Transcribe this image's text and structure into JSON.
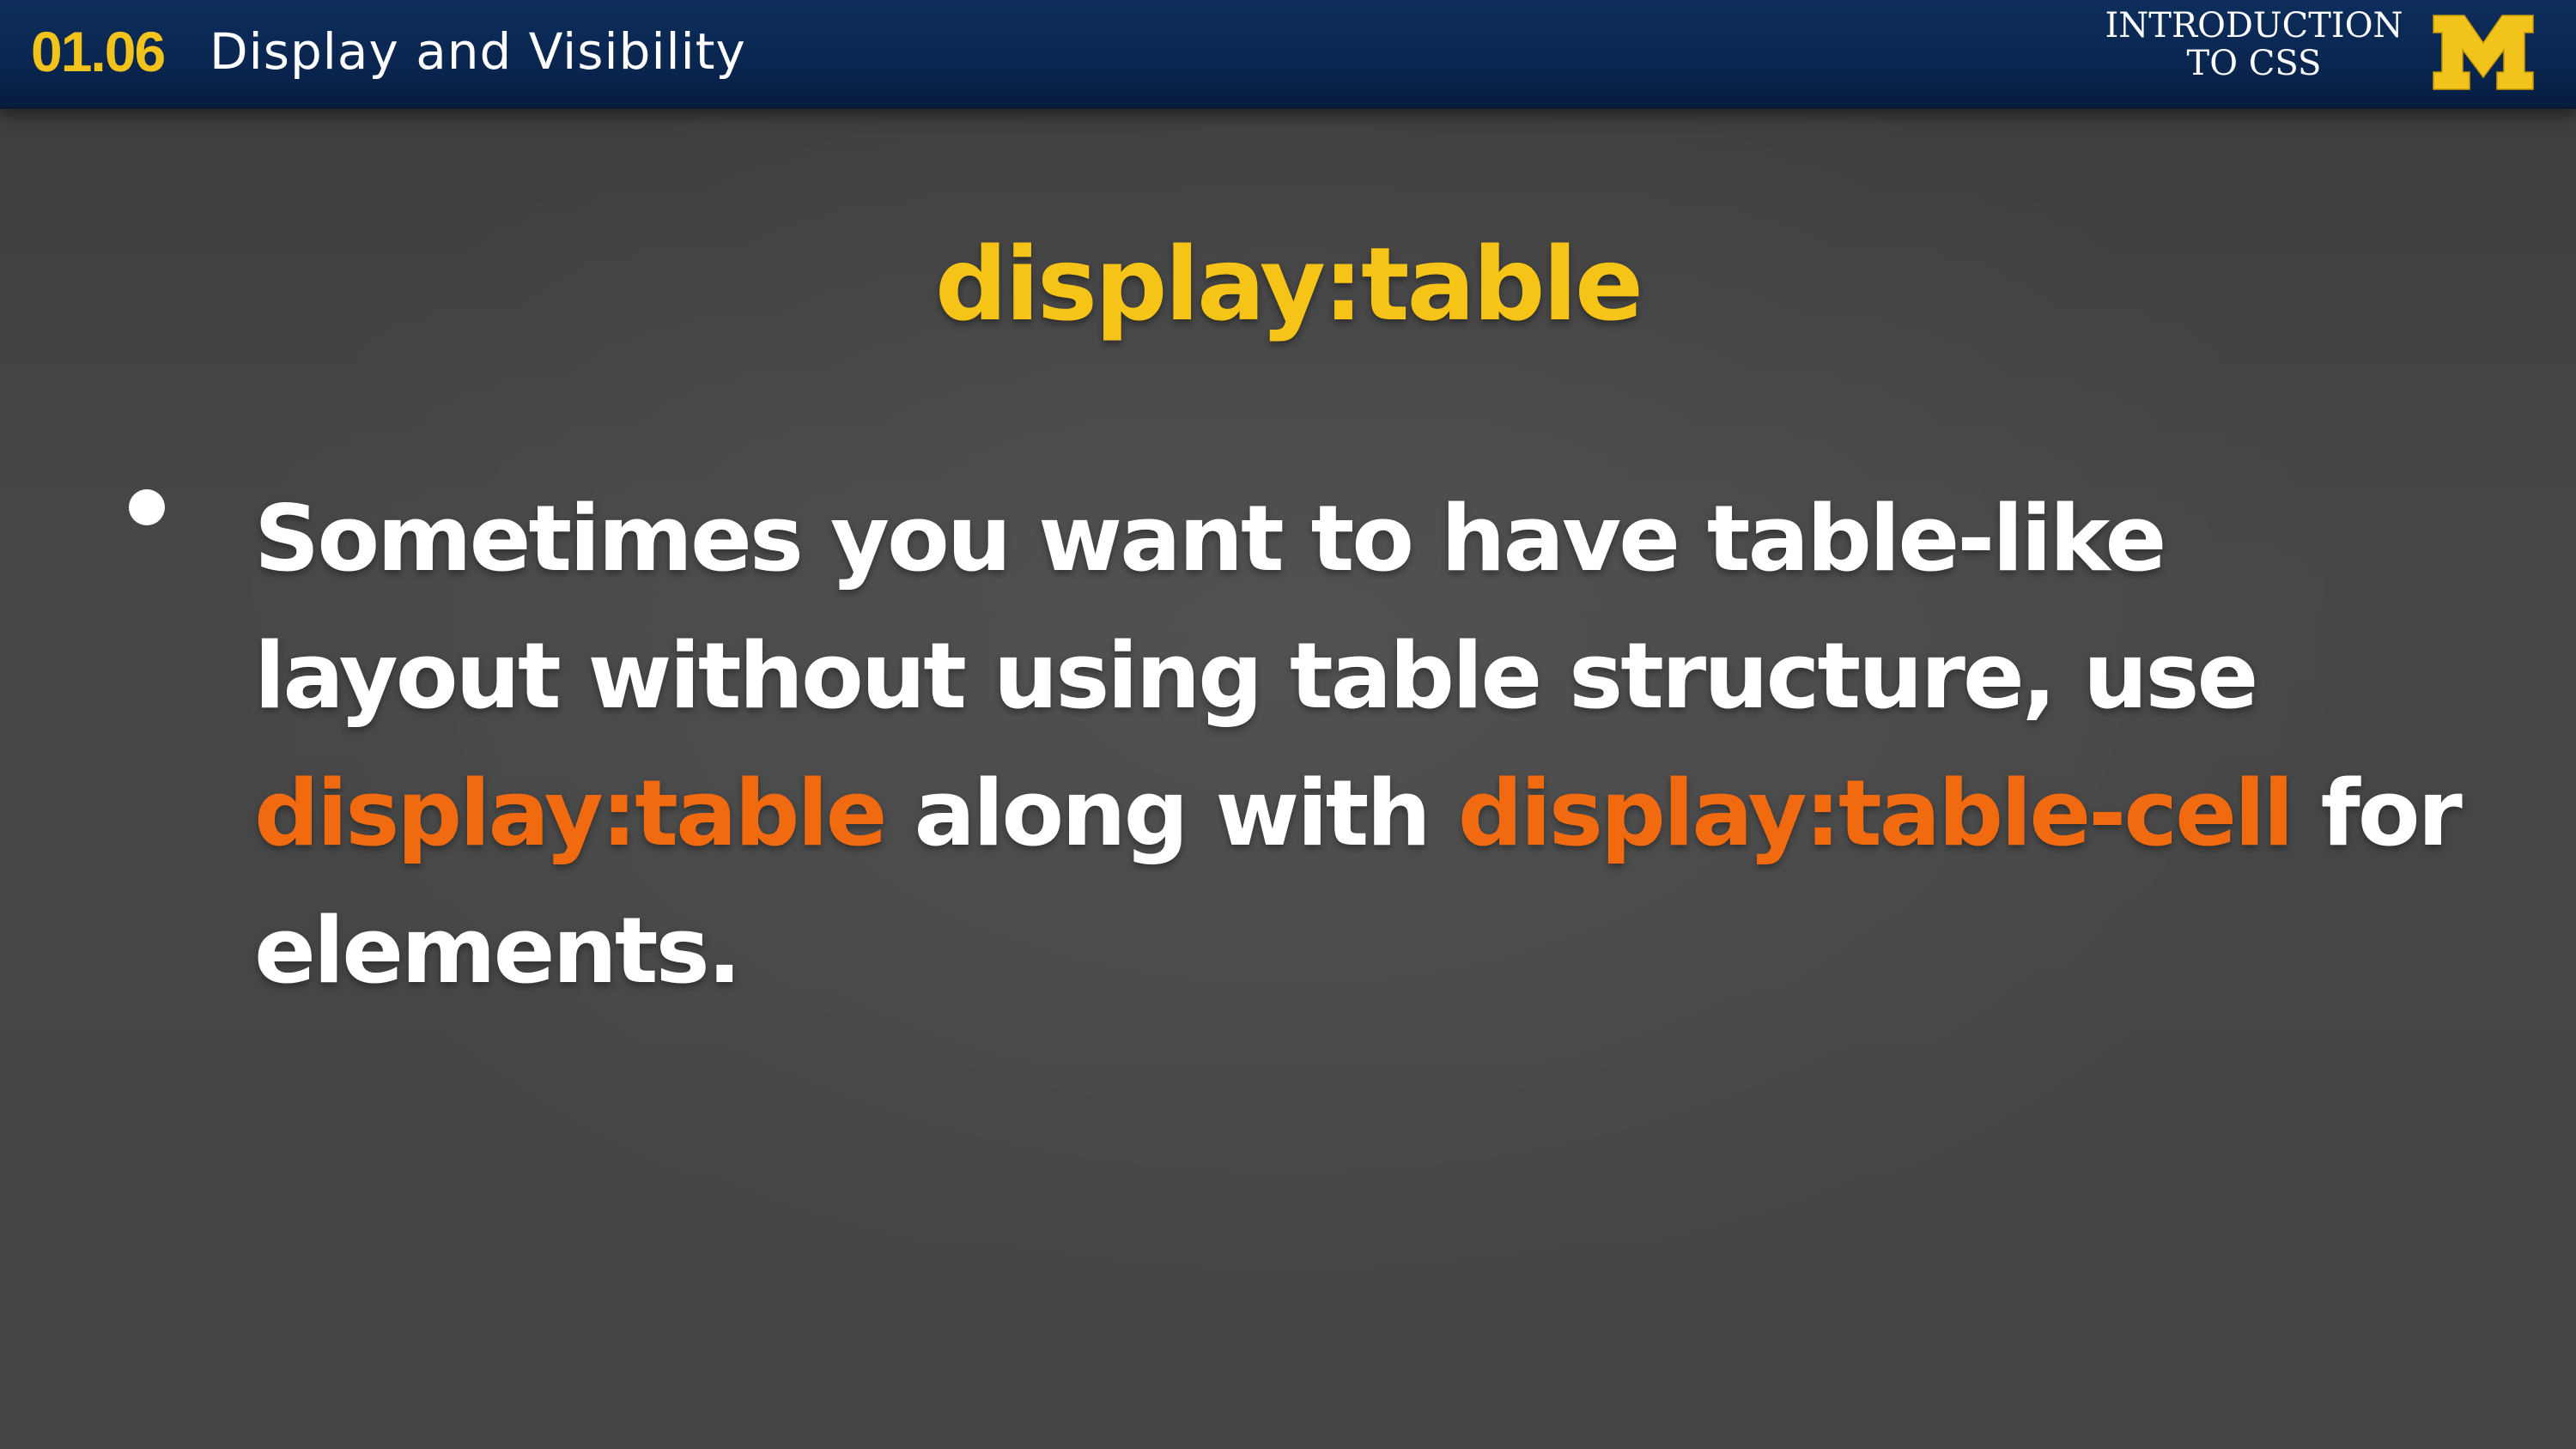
{
  "header": {
    "lesson_number": "01.06",
    "lesson_title": "Display and Visibility",
    "course_title_line1": "INTRODUCTION",
    "course_title_line2": "TO CSS",
    "logo_icon": "block-m-logo-icon",
    "logo_letter": "M"
  },
  "slide": {
    "heading": "display:table",
    "bullet": {
      "line1": "Sometimes you want to have table-like",
      "line2": "layout without using table structure, use",
      "line3_code1": "display:table",
      "line3_text1": " along with ",
      "line3_code2": "display:table-cell",
      "line3_text2": " for",
      "line4": "elements."
    }
  },
  "colors": {
    "header_bg": "#0a2650",
    "accent_maize": "#f2c31a",
    "code_orange": "#f26a0f",
    "slide_bg": "#434343",
    "text_white": "#ffffff"
  }
}
